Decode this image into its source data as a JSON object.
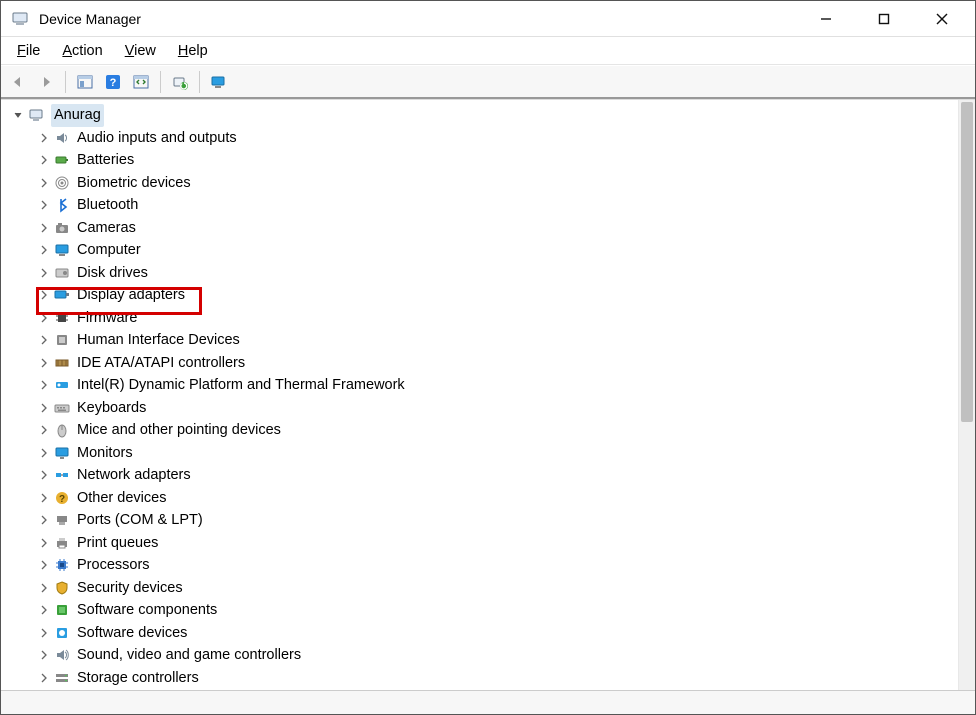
{
  "window": {
    "title": "Device Manager"
  },
  "menubar": {
    "items": [
      {
        "label": "File",
        "hotkey": "F"
      },
      {
        "label": "Action",
        "hotkey": "A"
      },
      {
        "label": "View",
        "hotkey": "V"
      },
      {
        "label": "Help",
        "hotkey": "H"
      }
    ]
  },
  "toolbar": {
    "buttons": [
      {
        "name": "nav-back-icon"
      },
      {
        "name": "nav-forward-icon"
      },
      {
        "name": "_sep"
      },
      {
        "name": "show-hide-tree-icon"
      },
      {
        "name": "help-icon"
      },
      {
        "name": "properties-icon"
      },
      {
        "name": "_sep"
      },
      {
        "name": "scan-hardware-icon"
      },
      {
        "name": "_sep"
      },
      {
        "name": "monitor-icon"
      }
    ]
  },
  "tree": {
    "root": {
      "label": "Anurag",
      "expanded": true,
      "selected": true
    },
    "categories": [
      {
        "label": "Audio inputs and outputs",
        "icon": "speaker-icon"
      },
      {
        "label": "Batteries",
        "icon": "battery-icon"
      },
      {
        "label": "Biometric devices",
        "icon": "fingerprint-icon"
      },
      {
        "label": "Bluetooth",
        "icon": "bluetooth-icon"
      },
      {
        "label": "Cameras",
        "icon": "camera-icon"
      },
      {
        "label": "Computer",
        "icon": "computer-icon"
      },
      {
        "label": "Disk drives",
        "icon": "disk-icon"
      },
      {
        "label": "Display adapters",
        "icon": "display-adapter-icon",
        "highlighted": true
      },
      {
        "label": "Firmware",
        "icon": "chip-icon"
      },
      {
        "label": "Human Interface Devices",
        "icon": "hid-icon"
      },
      {
        "label": "IDE ATA/ATAPI controllers",
        "icon": "ide-icon"
      },
      {
        "label": "Intel(R) Dynamic Platform and Thermal Framework",
        "icon": "thermal-icon"
      },
      {
        "label": "Keyboards",
        "icon": "keyboard-icon"
      },
      {
        "label": "Mice and other pointing devices",
        "icon": "mouse-icon"
      },
      {
        "label": "Monitors",
        "icon": "monitor-icon"
      },
      {
        "label": "Network adapters",
        "icon": "network-icon"
      },
      {
        "label": "Other devices",
        "icon": "unknown-icon"
      },
      {
        "label": "Ports (COM & LPT)",
        "icon": "port-icon"
      },
      {
        "label": "Print queues",
        "icon": "printer-icon"
      },
      {
        "label": "Processors",
        "icon": "processor-icon"
      },
      {
        "label": "Security devices",
        "icon": "security-icon"
      },
      {
        "label": "Software components",
        "icon": "software-component-icon"
      },
      {
        "label": "Software devices",
        "icon": "software-device-icon"
      },
      {
        "label": "Sound, video and game controllers",
        "icon": "sound-icon"
      },
      {
        "label": "Storage controllers",
        "icon": "storage-icon"
      }
    ]
  }
}
